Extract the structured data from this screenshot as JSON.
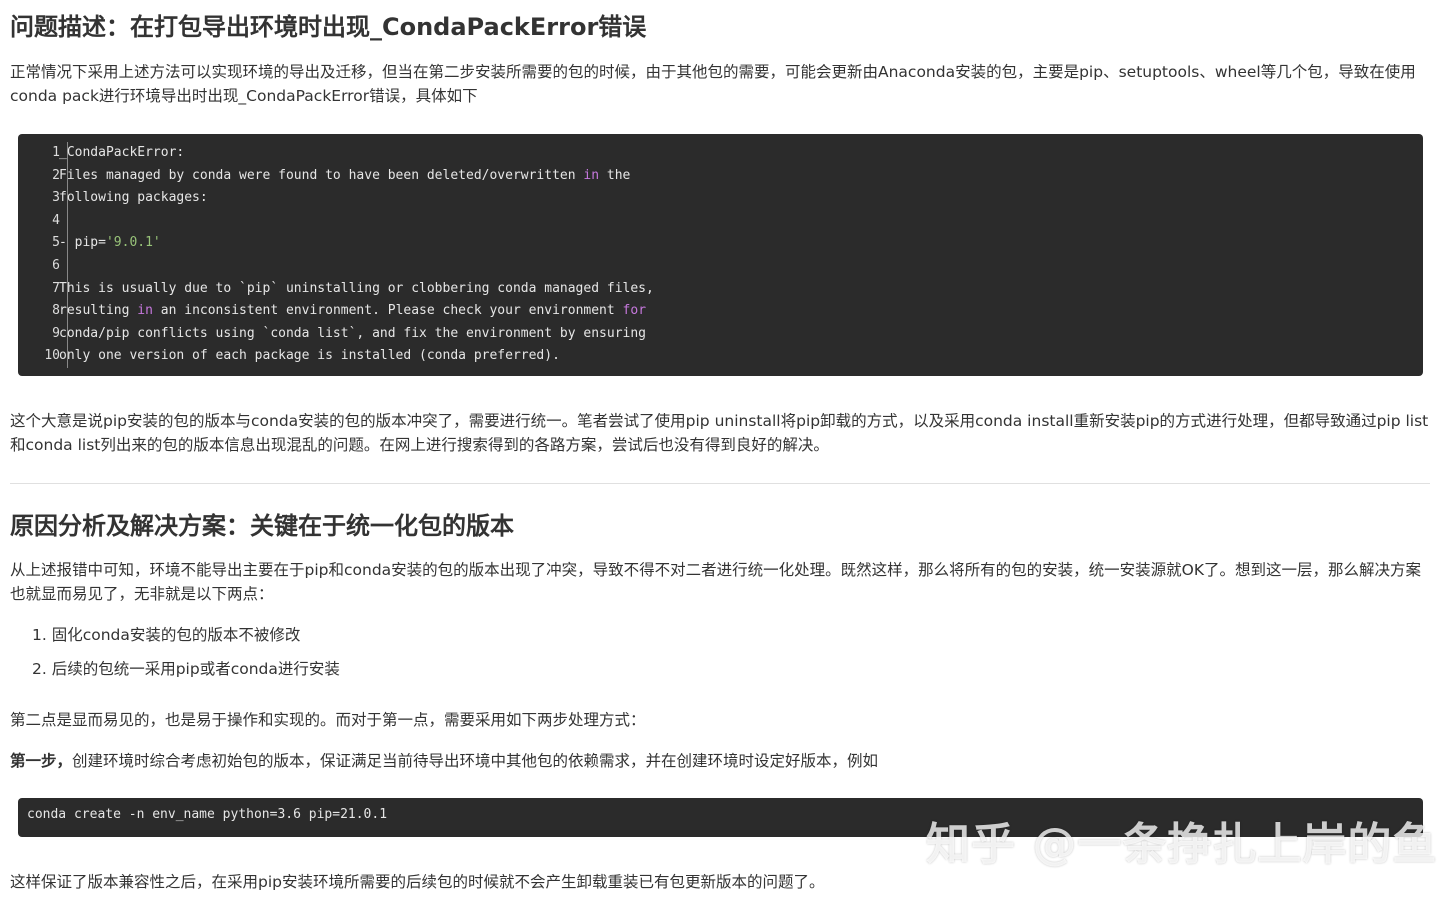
{
  "section1": {
    "heading": "问题描述：在打包导出环境时出现_CondaPackError错误",
    "intro": "正常情况下采用上述方法可以实现环境的导出及迁移，但当在第二步安装所需要的包的时候，由于其他包的需要，可能会更新由Anaconda安装的包，主要是pip、setuptools、wheel等几个包，导致在使用conda pack进行环境导出时出现_CondaPackError错误，具体如下",
    "code_lines": [
      {
        "num": "1",
        "segments": [
          {
            "text": "_CondaPackError:",
            "style": "plain"
          }
        ]
      },
      {
        "num": "2",
        "segments": [
          {
            "text": "Files managed by conda were found to have been deleted/overwritten ",
            "style": "plain"
          },
          {
            "text": "in",
            "style": "kw"
          },
          {
            "text": " the",
            "style": "plain"
          }
        ]
      },
      {
        "num": "3",
        "segments": [
          {
            "text": "following packages:",
            "style": "plain"
          }
        ]
      },
      {
        "num": "4",
        "segments": [
          {
            "text": "",
            "style": "plain"
          }
        ]
      },
      {
        "num": "5",
        "segments": [
          {
            "text": "- pip=",
            "style": "plain"
          },
          {
            "text": "'9.0.1'",
            "style": "str"
          }
        ]
      },
      {
        "num": "6",
        "segments": [
          {
            "text": "",
            "style": "plain"
          }
        ]
      },
      {
        "num": "7",
        "segments": [
          {
            "text": "This is usually due to `pip` uninstalling or clobbering conda managed files,",
            "style": "plain"
          }
        ]
      },
      {
        "num": "8",
        "segments": [
          {
            "text": "resulting ",
            "style": "plain"
          },
          {
            "text": "in",
            "style": "kw"
          },
          {
            "text": " an inconsistent environment. Please check your environment ",
            "style": "plain"
          },
          {
            "text": "for",
            "style": "kw"
          }
        ]
      },
      {
        "num": "9",
        "segments": [
          {
            "text": "conda/pip conflicts using `conda list`, and fix the environment by ensuring",
            "style": "plain"
          }
        ]
      },
      {
        "num": "10",
        "segments": [
          {
            "text": "only one version of each package is installed (conda preferred).",
            "style": "plain"
          }
        ]
      }
    ],
    "explanation": "这个大意是说pip安装的包的版本与conda安装的包的版本冲突了，需要进行统一。笔者尝试了使用pip uninstall将pip卸载的方式，以及采用conda install重新安装pip的方式进行处理，但都导致通过pip list和conda list列出来的包的版本信息出现混乱的问题。在网上进行搜索得到的各路方案，尝试后也没有得到良好的解决。"
  },
  "section2": {
    "heading": "原因分析及解决方案：关键在于统一化包的版本",
    "intro": "从上述报错中可知，环境不能导出主要在于pip和conda安装的包的版本出现了冲突，导致不得不对二者进行统一化处理。既然这样，那么将所有的包的安装，统一安装源就OK了。想到这一层，那么解决方案也就显而易见了，无非就是以下两点：",
    "list": [
      "1. 固化conda安装的包的版本不被修改",
      "2. 后续的包统一采用pip或者conda进行安装"
    ],
    "para2": "第二点是显而易见的，也是易于操作和实现的。而对于第一点，需要采用如下两步处理方式：",
    "step1_label": "第一步，",
    "step1_text": "创建环境时综合考虑初始包的版本，保证满足当前待导出环境中其他包的依赖需求，并在创建环境时设定好版本，例如",
    "command": "conda create -n env_name python=3.6 pip=21.0.1",
    "closing": "这样保证了版本兼容性之后，在采用pip安装环境所需要的后续包的时候就不会产生卸载重装已有包更新版本的问题了。"
  },
  "watermark": "知乎 @一条挣扎上岸的鱼",
  "colors": {
    "code_bg": "#2b2b2b",
    "code_text": "#e6e6e6",
    "keyword": "#c678dd",
    "string": "#98c379",
    "body_text": "#333333"
  }
}
